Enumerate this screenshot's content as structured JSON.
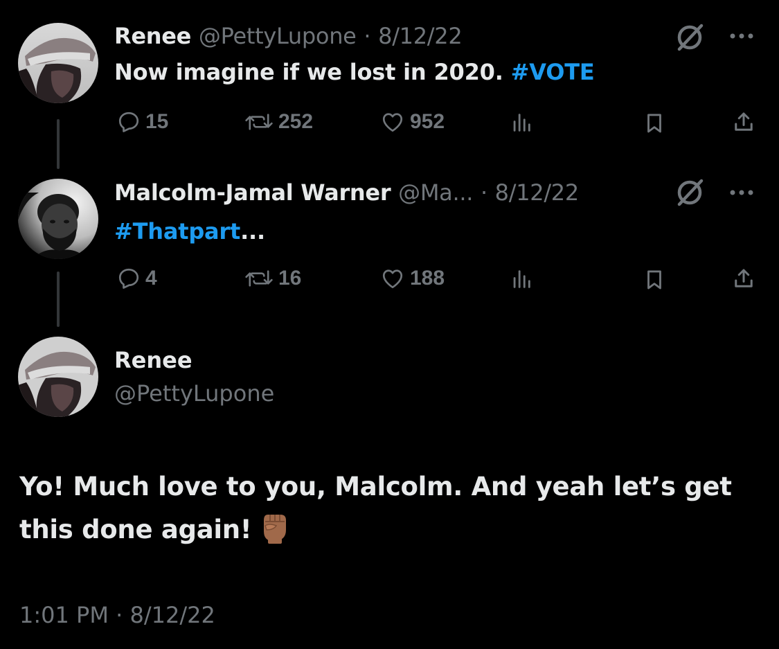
{
  "colors": {
    "background": "#000000",
    "text_primary": "#e7e9ea",
    "text_secondary": "#71767b",
    "accent": "#1d9bf0",
    "thread_line": "#333639"
  },
  "tweets": [
    {
      "name": "Renee",
      "handle": "@PettyLupone",
      "separator": "·",
      "date": "8/12/22",
      "text_plain": "Now imagine if we lost in 2020.",
      "text_hashtag": "#VOTE",
      "stats": {
        "replies": "15",
        "retweets": "252",
        "likes": "952"
      },
      "icons": [
        "no-sign-icon",
        "more-icon",
        "reply-icon",
        "retweet-icon",
        "like-icon",
        "views-icon",
        "bookmark-icon",
        "share-icon"
      ]
    },
    {
      "name": "Malcolm-Jamal Warner",
      "handle": "@Ma...",
      "separator": "·",
      "date": "8/12/22",
      "text_hashtag": "#Thatpart",
      "text_plain": "...",
      "stats": {
        "replies": "4",
        "retweets": "16",
        "likes": "188"
      },
      "icons": [
        "no-sign-icon",
        "more-icon",
        "reply-icon",
        "retweet-icon",
        "like-icon",
        "views-icon",
        "bookmark-icon",
        "share-icon"
      ]
    }
  ],
  "focal": {
    "name": "Renee",
    "handle": "@PettyLupone",
    "body": "Yo! Much love to you, Malcolm. And yeah let’s get this done again!",
    "emoji": "raised-fist-medium-dark-skin",
    "timestamp": "1:01 PM · 8/12/22"
  }
}
